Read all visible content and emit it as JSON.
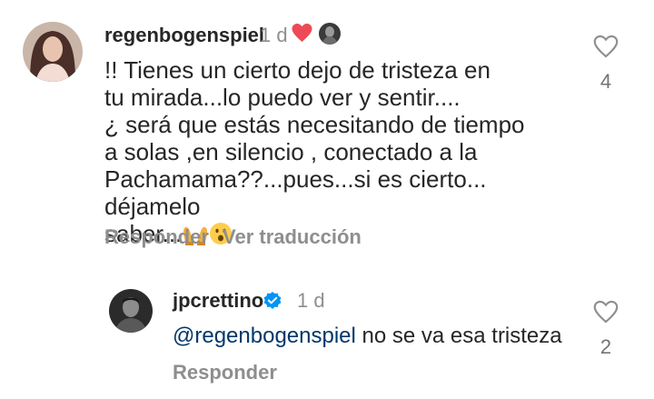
{
  "comment": {
    "username": "regenbogenspiel",
    "time": "1 d",
    "text": "!! Tienes un cierto dejo de tristeza en\ntu mirada...lo puedo ver y sentir....\n¿ será que estás necesitando de tiempo\na solas ,en silencio , conectado a la\nPachamama??...pues...si es cierto... déjamelo\nsaber...",
    "emojis": [
      "raising-hands-emoji",
      "hushed-face-emoji"
    ],
    "like_count": "4",
    "reply_label": "Responder",
    "translate_label": "Ver traducción",
    "creator_liked_icon": "heart-icon",
    "colors": {
      "heart": "#ed4956",
      "text": "#262626",
      "secondary": "#8e8e8e"
    }
  },
  "reply": {
    "username": "jpcrettino",
    "verified_icon": "verified-badge-icon",
    "time": "1 d",
    "mention": "@regenbogenspiel",
    "text": " no se va esa tristeza",
    "like_count": "2",
    "reply_label": "Responder",
    "colors": {
      "verified": "#0095f6",
      "mention": "#00376b"
    }
  }
}
